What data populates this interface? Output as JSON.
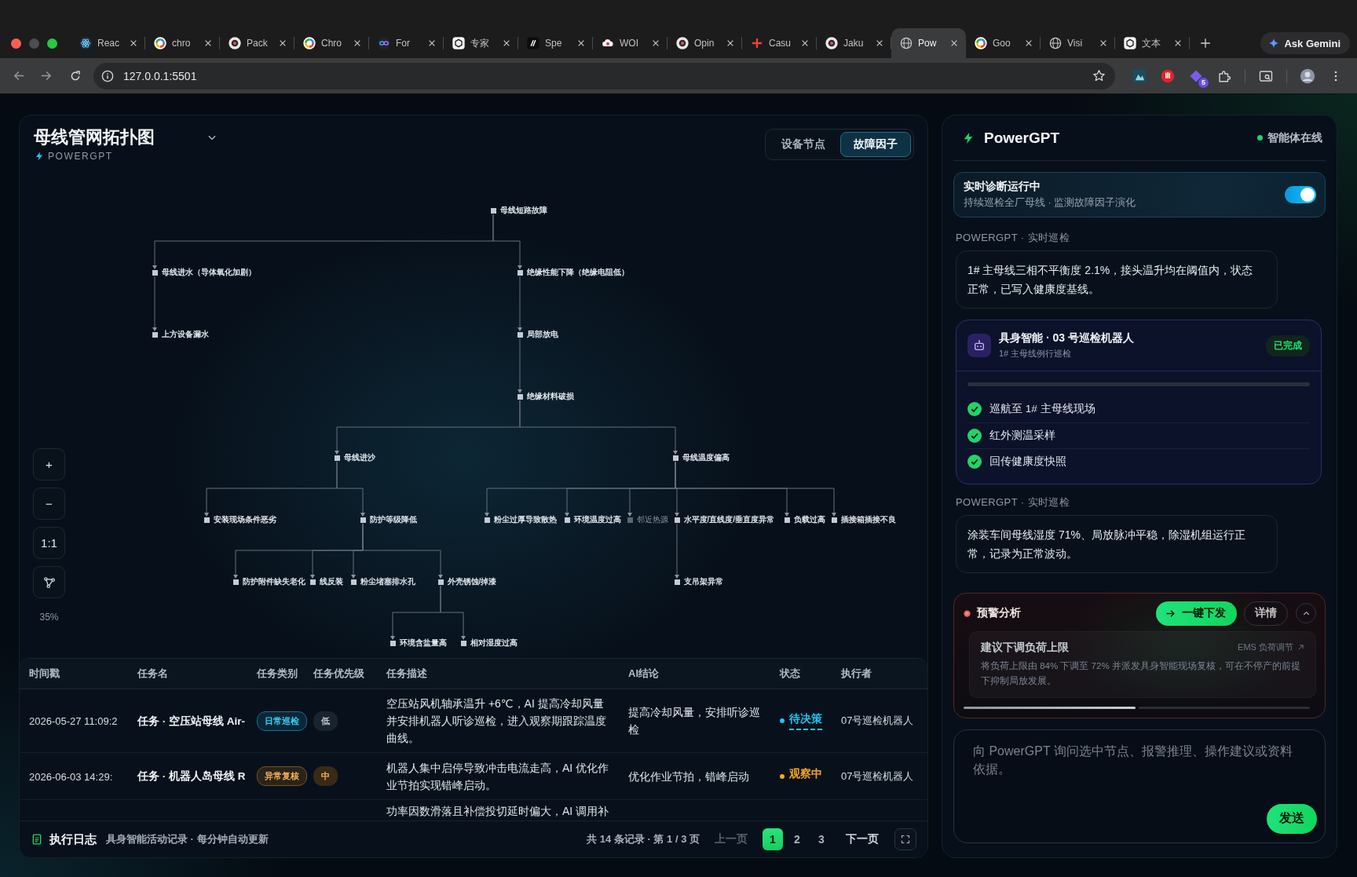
{
  "browser": {
    "tabs": [
      {
        "title": "Reac",
        "selected": false
      },
      {
        "title": "chro",
        "selected": false
      },
      {
        "title": "Pack",
        "selected": false
      },
      {
        "title": "Chro",
        "selected": false
      },
      {
        "title": "For",
        "selected": false
      },
      {
        "title": "专家",
        "selected": false
      },
      {
        "title": "Spe",
        "selected": false
      },
      {
        "title": "WOI",
        "selected": false
      },
      {
        "title": "Opin",
        "selected": false
      },
      {
        "title": "Casu",
        "selected": false
      },
      {
        "title": "Jaku",
        "selected": false
      },
      {
        "title": "Pow",
        "selected": true
      },
      {
        "title": "Goo",
        "selected": false
      },
      {
        "title": "Visi",
        "selected": false
      },
      {
        "title": "文本",
        "selected": false
      }
    ],
    "gemini_button": "Ask Gemini",
    "address": "127.0.0.1:5501",
    "extension_badge": "5"
  },
  "topology": {
    "title": "母线管网拓扑图",
    "subtitle": "POWERGPT",
    "view_tabs": [
      {
        "label": "设备节点",
        "selected": false
      },
      {
        "label": "故障因子",
        "selected": true
      }
    ],
    "tree": {
      "label": "母线短路故障",
      "muted": false,
      "children": [
        {
          "label": "母线进水（导体氧化加剧）",
          "muted": false,
          "children": [
            {
              "label": "上方设备漏水",
              "muted": false
            }
          ]
        },
        {
          "label": "绝缘性能下降（绝缘电阻低）",
          "muted": false,
          "children": [
            {
              "label": "局部放电",
              "muted": false,
              "children": [
                {
                  "label": "绝缘材料破损",
                  "muted": false,
                  "children": [
                    {
                      "label": "母线进沙",
                      "muted": false,
                      "children": [
                        {
                          "label": "安装现场条件恶劣",
                          "muted": false
                        },
                        {
                          "label": "防护等级降低",
                          "muted": false,
                          "children": [
                            {
                              "label": "防护附件缺失老化",
                              "muted": false
                            },
                            {
                              "label": "线反装",
                              "muted": false
                            },
                            {
                              "label": "粉尘堵塞排水孔",
                              "muted": false
                            },
                            {
                              "label": "外壳锈蚀/掉漆",
                              "muted": false,
                              "children": [
                                {
                                  "label": "环境含盐量高",
                                  "muted": false
                                },
                                {
                                  "label": "相对湿度过高",
                                  "muted": false
                                }
                              ]
                            }
                          ]
                        }
                      ]
                    },
                    {
                      "label": "母线温度偏高",
                      "muted": false,
                      "children": [
                        {
                          "label": "粉尘过厚导致散热",
                          "muted": false
                        },
                        {
                          "label": "环境温度过高",
                          "muted": false
                        },
                        {
                          "label": "邻近热源",
                          "muted": true
                        },
                        {
                          "label": "水平度/直线度/垂直度异常",
                          "muted": false,
                          "children": [
                            {
                              "label": "支吊架异常",
                              "muted": false
                            }
                          ]
                        },
                        {
                          "label": "负载过高",
                          "muted": false
                        },
                        {
                          "label": "插接箱插接不良",
                          "muted": false
                        }
                      ]
                    }
                  ]
                }
              ]
            }
          ]
        }
      ]
    },
    "zoom_controls": [
      "+",
      "−",
      "1:1"
    ],
    "zoom_level": "35%"
  },
  "log_table": {
    "columns": [
      "时间戳",
      "任务名",
      "任务类别",
      "任务优先级",
      "任务描述",
      "AI结论",
      "状态",
      "执行者"
    ],
    "rows": [
      {
        "time": "2026-05-27 11:09:2",
        "task": "任务 · 空压站母线 Air-",
        "category": {
          "label": "日常巡检",
          "kind": "routine"
        },
        "priority": {
          "label": "低",
          "kind": "low"
        },
        "description": "空压站风机轴承温升 +6℃，AI 提高冷却风量并安排机器人听诊巡检，进入观察期跟踪温度曲线。",
        "conclusion": "提高冷却风量，安排听诊巡检",
        "status": {
          "label": "待决策",
          "kind": "pending"
        },
        "executor": "07号巡检机器人"
      },
      {
        "time": "2026-06-03 14:29:",
        "task": "任务 · 机器人岛母线 R",
        "category": {
          "label": "异常复核",
          "kind": "review"
        },
        "priority": {
          "label": "中",
          "kind": "medium"
        },
        "description": "机器人集中启停导致冲击电流走高，AI 优化作业节拍实现错峰启动。",
        "conclusion": "优化作业节拍，错峰启动",
        "status": {
          "label": "观察中",
          "kind": "observing"
        },
        "executor": "07号巡检机器人"
      },
      {
        "description": "功率因数滑落且补偿投切延时偏大，AI 调用补"
      }
    ],
    "footer": {
      "title": "执行日志",
      "subtitle": "具身智能活动记录 · 每分钟自动更新",
      "summary": "共 14 条记录 · 第 1 / 3 页",
      "prev": {
        "label": "上一页",
        "disabled": true
      },
      "pages": [
        {
          "label": "1",
          "selected": true
        },
        {
          "label": "2",
          "selected": false
        },
        {
          "label": "3",
          "selected": false
        }
      ],
      "next": {
        "label": "下一页",
        "disabled": false
      }
    }
  },
  "assistant": {
    "title": "PowerGPT",
    "status": "智能体在线",
    "online": true,
    "live_card": {
      "title": "实时诊断运行中",
      "subtitle": "持续巡检全厂母线 · 监测故障因子演化",
      "on": true
    },
    "feed": [
      {
        "kind": "message",
        "source": "POWERGPT · 实时巡检",
        "text": "1# 主母线三相不平衡度 2.1%，接头温升均在阈值内，状态正常，已写入健康度基线。"
      },
      {
        "kind": "robot",
        "title": "具身智能 · 03 号巡检机器人",
        "subtitle": "1# 主母线例行巡检",
        "badge": "已完成",
        "level": 1,
        "steps": [
          {
            "label": "巡航至 1# 主母线现场",
            "done": true
          },
          {
            "label": "红外测温采样",
            "done": true
          },
          {
            "label": "回传健康度快照",
            "done": true
          }
        ]
      },
      {
        "kind": "message",
        "source": "POWERGPT · 实时巡检",
        "text": "涂装车间母线湿度 71%、局放脉冲平稳，除湿机组运行正常，记录为正常波动。"
      }
    ],
    "alert": {
      "title": "预警分析",
      "dispatch": "一键下发",
      "details": "详情",
      "expanded": true,
      "suggestion": {
        "title": "建议下调负荷上限",
        "link": "EMS 负荷调节",
        "text": "将负荷上限由 84% 下调至 72% 并派发具身智能现场复核，可在不停产的前提下抑制局放发展。"
      },
      "pager": [
        {
          "selected": true
        },
        {
          "selected": false
        }
      ]
    },
    "composer": {
      "placeholder": "向 PowerGPT 询问选中节点、报警推理、操作建议或资料依据。",
      "send": "发送"
    }
  }
}
